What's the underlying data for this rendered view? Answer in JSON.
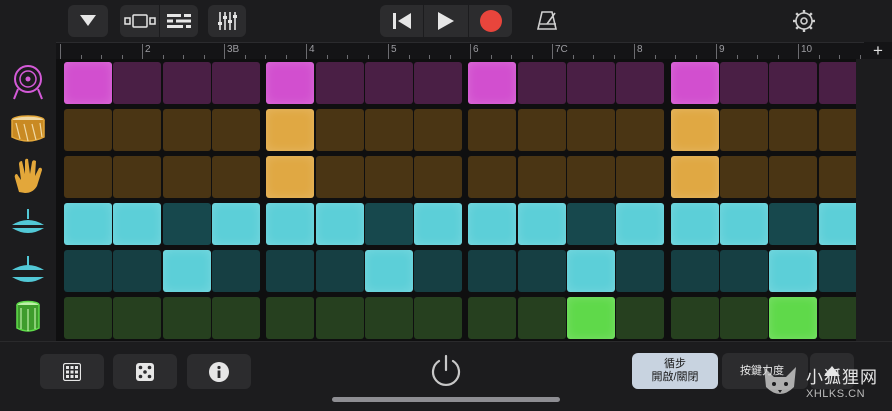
{
  "toolbar": {
    "browser_icon": "chevron-down-icon",
    "view_icons": [
      "tracks-view-icon",
      "mixer-icon"
    ],
    "eq_icon": "equalizer-icon",
    "transport": [
      "rewind-icon",
      "play-icon",
      "record-icon"
    ],
    "metronome_icon": "metronome-icon",
    "settings_icon": "gear-icon",
    "record_color": "#e8453c"
  },
  "ruler": {
    "bars": [
      "",
      "2",
      "3B",
      "4",
      "5",
      "6",
      "7C",
      "8",
      "9",
      "10"
    ],
    "add_label": "+"
  },
  "instruments": [
    {
      "name": "kick",
      "icon": "kick-drum-icon",
      "color": "#d45ad8"
    },
    {
      "name": "snare",
      "icon": "snare-drum-icon",
      "color": "#e3a73a"
    },
    {
      "name": "clap",
      "icon": "clap-hand-icon",
      "color": "#e3a73a"
    },
    {
      "name": "hihat-closed",
      "icon": "hi-hat-icon",
      "color": "#52c8d6"
    },
    {
      "name": "hihat-open",
      "icon": "hi-hat-open-icon",
      "color": "#52c8d6"
    },
    {
      "name": "tom",
      "icon": "tom-drum-icon",
      "color": "#5fdc4a"
    }
  ],
  "pattern": [
    [
      1,
      0,
      0,
      0,
      1,
      0,
      0,
      0,
      1,
      0,
      0,
      0,
      1,
      0,
      0,
      0
    ],
    [
      0,
      0,
      0,
      0,
      1,
      0,
      0,
      0,
      0,
      0,
      0,
      0,
      1,
      0,
      0,
      0
    ],
    [
      0,
      0,
      0,
      0,
      1,
      0,
      0,
      0,
      0,
      0,
      0,
      0,
      1,
      0,
      0,
      0
    ],
    [
      1,
      1,
      0,
      1,
      1,
      1,
      0,
      1,
      1,
      1,
      0,
      1,
      1,
      1,
      0,
      1
    ],
    [
      0,
      0,
      1,
      0,
      0,
      0,
      1,
      0,
      0,
      0,
      1,
      0,
      0,
      0,
      1,
      0
    ],
    [
      0,
      0,
      0,
      0,
      0,
      0,
      0,
      0,
      0,
      0,
      1,
      0,
      0,
      0,
      1,
      0
    ]
  ],
  "row_colors": [
    {
      "on": "#d24fcf",
      "off": "#4a1f45"
    },
    {
      "on": "#e0a843",
      "off": "#4a3514"
    },
    {
      "on": "#e0a843",
      "off": "#4a3514"
    },
    {
      "on": "#5ccfd8",
      "off": "#17484d"
    },
    {
      "on": "#5ccfd8",
      "off": "#163f43"
    },
    {
      "on": "#5fd94a",
      "off": "#26401f"
    }
  ],
  "bottom": {
    "buttons": [
      "grid-icon",
      "dice-icon",
      "info-icon"
    ],
    "power_icon": "power-icon",
    "step_mode_line1": "循步",
    "step_mode_line2": "開啟/關閉",
    "play_mode_label": "按鍵力度",
    "up_icon": "triangle-up-icon"
  },
  "watermark": {
    "cn": "小狐狸网",
    "en": "XHLKS.CN"
  }
}
